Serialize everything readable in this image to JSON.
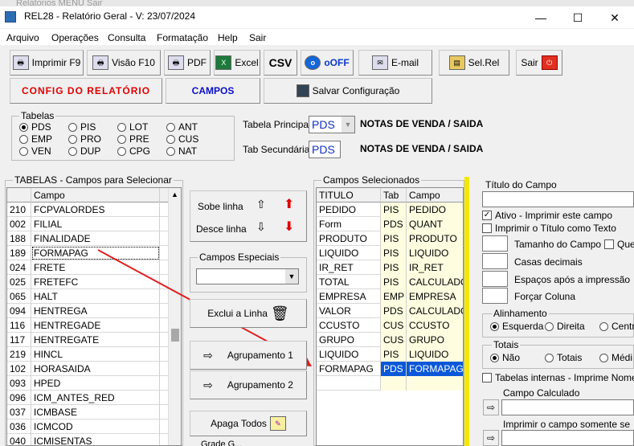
{
  "window": {
    "title": "REL28 - Relatório Geral - V: 23/07/2024",
    "minimize": "—",
    "maximize": "☐",
    "close": "✕",
    "background_strip": "Relatorios  MENU  Sair"
  },
  "menu": [
    "Arquivo",
    "Operações",
    "Consulta",
    "Formatação",
    "Help",
    "Sair"
  ],
  "toolbar": {
    "print": "Imprimir F9",
    "preview": "Visão F10",
    "pdf": "PDF",
    "excel": "Excel",
    "csv": "CSV",
    "off": "oOFF",
    "email": "E-mail",
    "selrel": "Sel.Rel",
    "exit": "Sair"
  },
  "tabs": {
    "config": "CONFIG DO RELATÓRIO",
    "campos": "CAMPOS",
    "save": "Salvar Configuração"
  },
  "tabelas": {
    "label": "Tabelas",
    "options": [
      {
        "label": "PDS",
        "checked": true
      },
      {
        "label": "PIS",
        "checked": false
      },
      {
        "label": "LOT",
        "checked": false
      },
      {
        "label": "ANT",
        "checked": false
      },
      {
        "label": "EMP",
        "checked": false
      },
      {
        "label": "PRO",
        "checked": false
      },
      {
        "label": "PRE",
        "checked": false
      },
      {
        "label": "CUS",
        "checked": false
      },
      {
        "label": "VEN",
        "checked": false
      },
      {
        "label": "DUP",
        "checked": false
      },
      {
        "label": "CPG",
        "checked": false
      },
      {
        "label": "NAT",
        "checked": false
      }
    ],
    "principal_label": "Tabela Principal",
    "principal_value": "PDS",
    "principal_desc": "NOTAS DE VENDA / SAIDA",
    "secundaria_label": "Tab Secundária",
    "secundaria_value": "PDS",
    "secundaria_desc": "NOTAS DE VENDA / SAIDA"
  },
  "left_panel": {
    "label": "TABELAS - Campos para Selecionar",
    "header": "Campo",
    "rows": [
      {
        "code": "210",
        "name": "FCPVALORDES"
      },
      {
        "code": "002",
        "name": "FILIAL"
      },
      {
        "code": "188",
        "name": "FINALIDADE"
      },
      {
        "code": "189",
        "name": "FORMAPAG"
      },
      {
        "code": "024",
        "name": "FRETE"
      },
      {
        "code": "025",
        "name": "FRETEFC"
      },
      {
        "code": "065",
        "name": "HALT"
      },
      {
        "code": "094",
        "name": "HENTREGA"
      },
      {
        "code": "116",
        "name": "HENTREGADE"
      },
      {
        "code": "117",
        "name": "HENTREGATE"
      },
      {
        "code": "219",
        "name": "HINCL"
      },
      {
        "code": "102",
        "name": "HORASAIDA"
      },
      {
        "code": "093",
        "name": "HPED"
      },
      {
        "code": "096",
        "name": "ICM_ANTES_RED"
      },
      {
        "code": "037",
        "name": "ICMBASE"
      },
      {
        "code": "036",
        "name": "ICMCOD"
      },
      {
        "code": "040",
        "name": "ICMISENTAS"
      },
      {
        "code": "041",
        "name": "ICMOUTRAS"
      }
    ]
  },
  "middle": {
    "sobe": "Sobe linha",
    "desce": "Desce linha",
    "especiais_label": "Campos Especiais",
    "exclui": "Exclui a Linha",
    "agrup1": "Agrupamento 1",
    "agrup2": "Agrupamento 2",
    "apaga": "Apaga Todos",
    "bottom_cut": "Grade G..."
  },
  "selected": {
    "label": "Campos Selecionados",
    "headers": [
      "TITULO",
      "Tab",
      "Campo"
    ],
    "rows": [
      {
        "titulo": "PEDIDO",
        "tab": "PIS",
        "campo": "PEDIDO"
      },
      {
        "titulo": "Form",
        "tab": "PDS",
        "campo": "QUANT"
      },
      {
        "titulo": "PRODUTO",
        "tab": "PIS",
        "campo": "PRODUTO"
      },
      {
        "titulo": "LIQUIDO",
        "tab": "PIS",
        "campo": "LIQUIDO"
      },
      {
        "titulo": "IR_RET",
        "tab": "PIS",
        "campo": "IR_RET"
      },
      {
        "titulo": "TOTAL",
        "tab": "PIS",
        "campo": "CALCULADO_"
      },
      {
        "titulo": "EMPRESA",
        "tab": "EMP",
        "campo": "EMPRESA"
      },
      {
        "titulo": "VALOR",
        "tab": "PDS",
        "campo": "CALCULADO_"
      },
      {
        "titulo": "CCUSTO",
        "tab": "CUS",
        "campo": "CCUSTO"
      },
      {
        "titulo": "GRUPO",
        "tab": "CUS",
        "campo": "GRUPO"
      },
      {
        "titulo": "LIQUIDO",
        "tab": "PIS",
        "campo": "LIQUIDO"
      },
      {
        "titulo": "FORMAPAG",
        "tab": "PDS",
        "campo": "FORMAPAG"
      }
    ]
  },
  "right": {
    "titulo_label": "Título do Campo",
    "ativo": "Ativo - Imprimir este campo",
    "imprimir_titulo": "Imprimir o Título como Texto",
    "tamanho": "Tamanho do Campo",
    "que": "Que",
    "casas": "Casas decimais",
    "espacos": "Espaços após a impressão",
    "forcar": "Forçar Coluna",
    "alinhamento": "Alinhamento",
    "esquerda": "Esquerda",
    "direita": "Direita",
    "centro": "Centr",
    "totais": "Totais",
    "nao": "Não",
    "tot": "Totais",
    "media": "Médi",
    "tabelas_internas": "Tabelas internas - Imprime Nome",
    "campo_calculado": "Campo Calculado",
    "imprimir_somente": "Imprimir o campo somente se"
  }
}
